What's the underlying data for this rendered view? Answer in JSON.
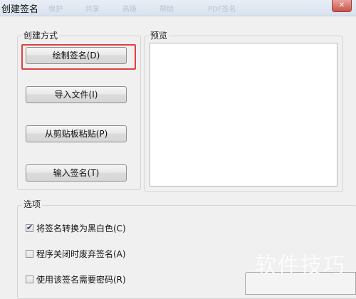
{
  "window": {
    "title": "创建签名",
    "ghost_menu": [
      "保护",
      "共享",
      "高级",
      "帮助",
      "PDF签名"
    ],
    "close_glyph": "✕"
  },
  "create_group": {
    "label": "创建方式",
    "buttons": [
      "绘制签名(D)",
      "导入文件(I)",
      "从剪贴板粘贴(P)",
      "输入签名(T)"
    ]
  },
  "preview_group": {
    "label": "预览"
  },
  "options_group": {
    "label": "选项",
    "items": [
      {
        "label": "将签名转换为黑白色(C)",
        "checked": true
      },
      {
        "label": "程序关闭时废弃签名(A)",
        "checked": false
      },
      {
        "label": "使用该签名需要密码(R)",
        "checked": false
      }
    ]
  },
  "watermark": "软件技巧",
  "colors": {
    "highlight": "#e04040",
    "close_button": "#c9544a"
  }
}
